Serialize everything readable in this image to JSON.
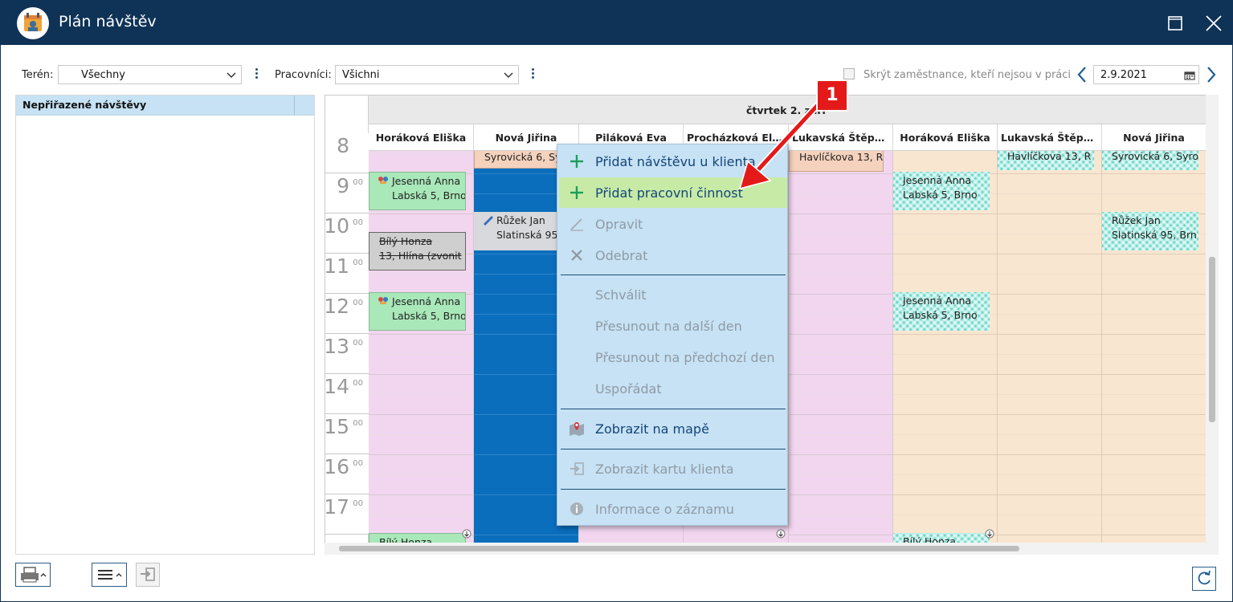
{
  "window": {
    "title": "Plán návštěv"
  },
  "filters": {
    "teren_label": "Terén:",
    "teren_value": "Všechny",
    "workers_label": "Pracovníci:",
    "workers_value": "Všichni",
    "hide_label": "Skrýt zaměstnance, kteří nejsou v práci",
    "date": "2.9.2021"
  },
  "left_panel": {
    "header": "Nepřiřazené návštěvy"
  },
  "calendar": {
    "day_header": "čtvrtek 2. září",
    "columns": [
      "Horáková Eliška",
      "Nová Jiřina",
      "Piláková Eva",
      "Procházková Eliš...",
      "Lukavská Štěpá...",
      "Horáková Eliška",
      "Lukavská Štěpá...",
      "Nová Jiřina"
    ],
    "hours": [
      "9",
      "10",
      "11",
      "12",
      "13",
      "14",
      "15",
      "16",
      "17"
    ],
    "hour_suffix": "00",
    "partial_hour": "8",
    "events": {
      "c1_jesenna_1a": "Jesenná Anna",
      "c1_jesenna_1b": "Labská 5, Brno",
      "c1_bily_a": "Bílý Honza",
      "c1_bily_b": "13, Hlína (zvonit",
      "c1_jesenna_2a": "Jesenná Anna",
      "c1_jesenna_2b": "Labská 5, Brno",
      "c1_bily_bottom": "Bílý Honza",
      "c2_syrovicka": "Syrovická 6, Syro",
      "c2_ruzek_a": "Růžek Jan",
      "c2_ruzek_b": "Slatinská 95, Brn",
      "c5_havlickova": "Havlíčkova 13, R",
      "c6_jesenna_1a": "Jesenná Anna",
      "c6_jesenna_1b": "Labská 5, Brno",
      "c6_jesenna_2a": "Jesenná Anna",
      "c6_jesenna_2b": "Labská 5, Brno",
      "c6_bily_bottom": "Bílý Honza",
      "c7_havlickova": "Havlíčkova 13, R",
      "c8_syrovicka": "Syrovická 6, Syro",
      "c8_ruzek_a": "Růžek Jan",
      "c8_ruzek_b": "Slatinská 95, Brn"
    }
  },
  "context_menu": {
    "add_visit": "Přidat návštěvu u klienta",
    "add_work": "Přidat pracovní činnost",
    "edit": "Opravit",
    "remove": "Odebrat",
    "approve": "Schválit",
    "move_next": "Přesunout na další den",
    "move_prev": "Přesunout na předchozí den",
    "arrange": "Uspořádat",
    "show_map": "Zobrazit na mapě",
    "show_card": "Zobrazit kartu klienta",
    "info": "Informace o záznamu"
  },
  "callout": {
    "number": "1"
  },
  "colors": {
    "titlebar": "#0f3357",
    "accent_blue": "#0a6ebd",
    "menu_bg": "#c6e2f4",
    "menu_highlight": "#c7eba7",
    "arrow_red": "#e41a1a"
  }
}
